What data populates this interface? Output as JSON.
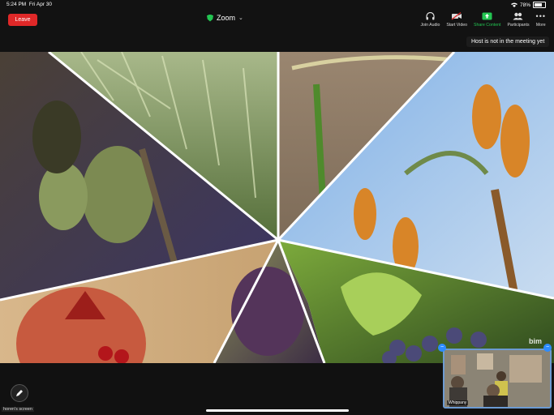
{
  "status_bar": {
    "time": "5:24 PM",
    "date": "Fri Apr 30",
    "battery": "78%",
    "wifi_icon": "wifi-icon",
    "battery_icon": "battery-icon"
  },
  "header": {
    "leave_label": "Leave",
    "title": "Zoom"
  },
  "toolbar": [
    {
      "label": "Join Audio",
      "icon": "headphones-icon"
    },
    {
      "label": "Start Video",
      "icon": "video-off-icon"
    },
    {
      "label": "Share Content",
      "icon": "share-screen-icon"
    },
    {
      "label": "Participants",
      "icon": "participants-icon"
    },
    {
      "label": "More",
      "icon": "more-icon"
    }
  ],
  "tooltip": "Host is not in the meeting yet",
  "self_view": {
    "name": "Whippany"
  },
  "share_label": "horen's screen",
  "watermark": "bim",
  "colors": {
    "leave": "#e02828",
    "share": "#23c552",
    "accent": "#2d8cff",
    "self_border": "#6c9bd2"
  }
}
